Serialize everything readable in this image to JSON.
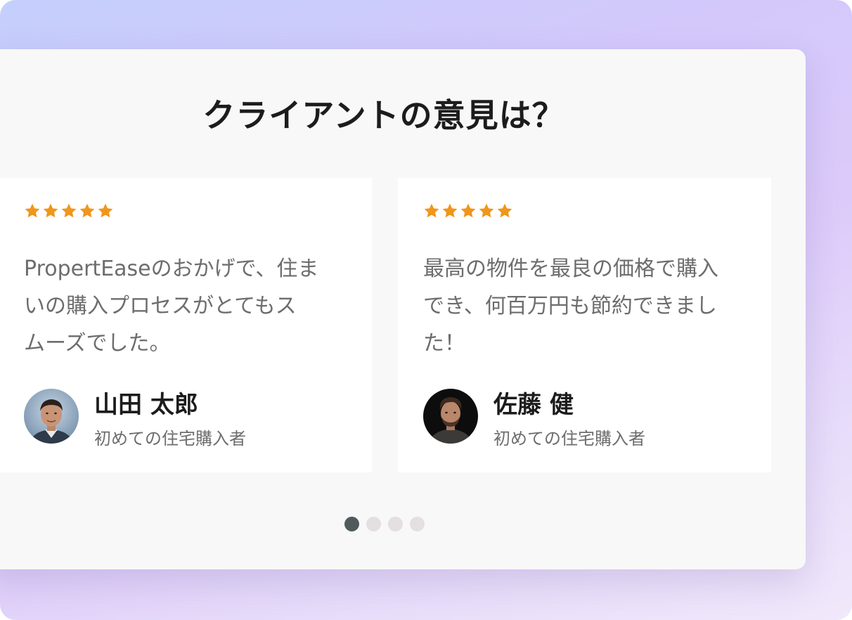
{
  "section": {
    "title": "クライアントの意見は？"
  },
  "testimonials": [
    {
      "rating": 5,
      "quote_lines": [
        "PropertEaseのおかげで、住ま",
        "いの購入プロセスがとてもス",
        "ムーズでした。"
      ],
      "name": "山田 太郎",
      "role": "初めての住宅購入者",
      "avatar_icon": "portrait-photo"
    },
    {
      "rating": 5,
      "quote_lines": [
        "最高の物件を最良の価格で購入",
        "でき、何百万円も節約できまし",
        "た！"
      ],
      "name": "佐藤 健",
      "role": "初めての住宅購入者",
      "avatar_icon": "portrait-photo"
    }
  ],
  "pagination": {
    "total": 4,
    "active": 1
  },
  "colors": {
    "star": "#f0961b",
    "heading": "#1c1c1c",
    "body_text": "#6d6d6d",
    "dot_active": "#515a5a",
    "dot_inactive": "#e4dfe0"
  }
}
